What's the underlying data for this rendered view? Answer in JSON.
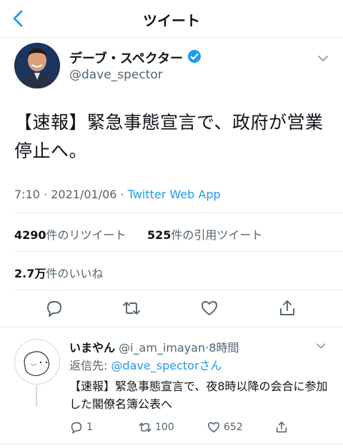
{
  "header": {
    "title": "ツイート"
  },
  "tweet": {
    "author_name": "デーブ・スペクター",
    "handle": "@dave_spector",
    "text": "【速報】緊急事態宣言で、政府が営業停止へ。",
    "time": "7:10",
    "sep": "·",
    "date": "2021/01/06",
    "app": "Twitter Web App",
    "retweets_count": "4290",
    "retweets_label": "件のリツイート",
    "quotes_count": "525",
    "quotes_label": "件の引用ツイート",
    "likes_count": "2.7万",
    "likes_label": "件のいいね"
  },
  "reply": {
    "name": "いまやん",
    "handle": "@i_am_imayan",
    "time": "·8時間",
    "reply_to_prefix": "返信先: ",
    "reply_to_handle": "@dave_spector",
    "reply_to_suffix": "さん",
    "text": "【速報】緊急事態宣言で、夜8時以降の会合に参加した閣僚名簿公表へ",
    "reply_count": "1",
    "retweet_count": "100",
    "like_count": "652"
  },
  "colors": {
    "accent": "#1d9bf0",
    "text": "#0f1419",
    "secondary": "#536471",
    "divider": "#e1e8ed"
  }
}
